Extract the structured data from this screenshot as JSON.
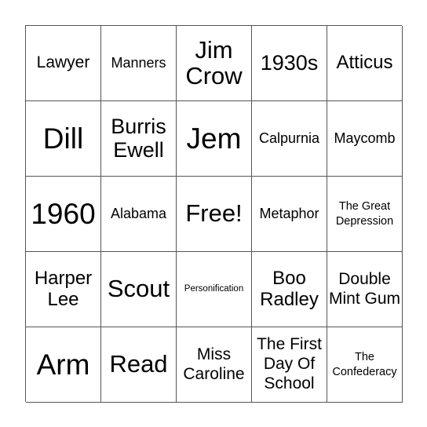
{
  "board": {
    "cells": [
      {
        "text": "Lawyer",
        "size": "s-ms"
      },
      {
        "text": "Manners",
        "size": "s-s"
      },
      {
        "text": "Jim Crow",
        "size": "s-l"
      },
      {
        "text": "1930s",
        "size": "s-ml"
      },
      {
        "text": "Atticus",
        "size": "s-m"
      },
      {
        "text": "Dill",
        "size": "s-xl"
      },
      {
        "text": "Burris Ewell",
        "size": "s-ml"
      },
      {
        "text": "Jem",
        "size": "s-xl"
      },
      {
        "text": "Calpurnia",
        "size": "s-s"
      },
      {
        "text": "Maycomb",
        "size": "s-s"
      },
      {
        "text": "1960",
        "size": "s-xl"
      },
      {
        "text": "Alabama",
        "size": "s-s"
      },
      {
        "text": "Free!",
        "size": "s-l"
      },
      {
        "text": "Metaphor",
        "size": "s-s"
      },
      {
        "text": "The Great Depression",
        "size": "s-xs"
      },
      {
        "text": "Harper Lee",
        "size": "s-m"
      },
      {
        "text": "Scout",
        "size": "s-l"
      },
      {
        "text": "Personification",
        "size": "s-xxs"
      },
      {
        "text": "Boo Radley",
        "size": "s-m"
      },
      {
        "text": "Double Mint Gum",
        "size": "s-ms"
      },
      {
        "text": "Arm",
        "size": "s-xl"
      },
      {
        "text": "Read",
        "size": "s-l"
      },
      {
        "text": "Miss Caroline",
        "size": "s-ms"
      },
      {
        "text": "The First Day Of School",
        "size": "s-ms"
      },
      {
        "text": "The Confederacy",
        "size": "s-xs"
      }
    ]
  }
}
